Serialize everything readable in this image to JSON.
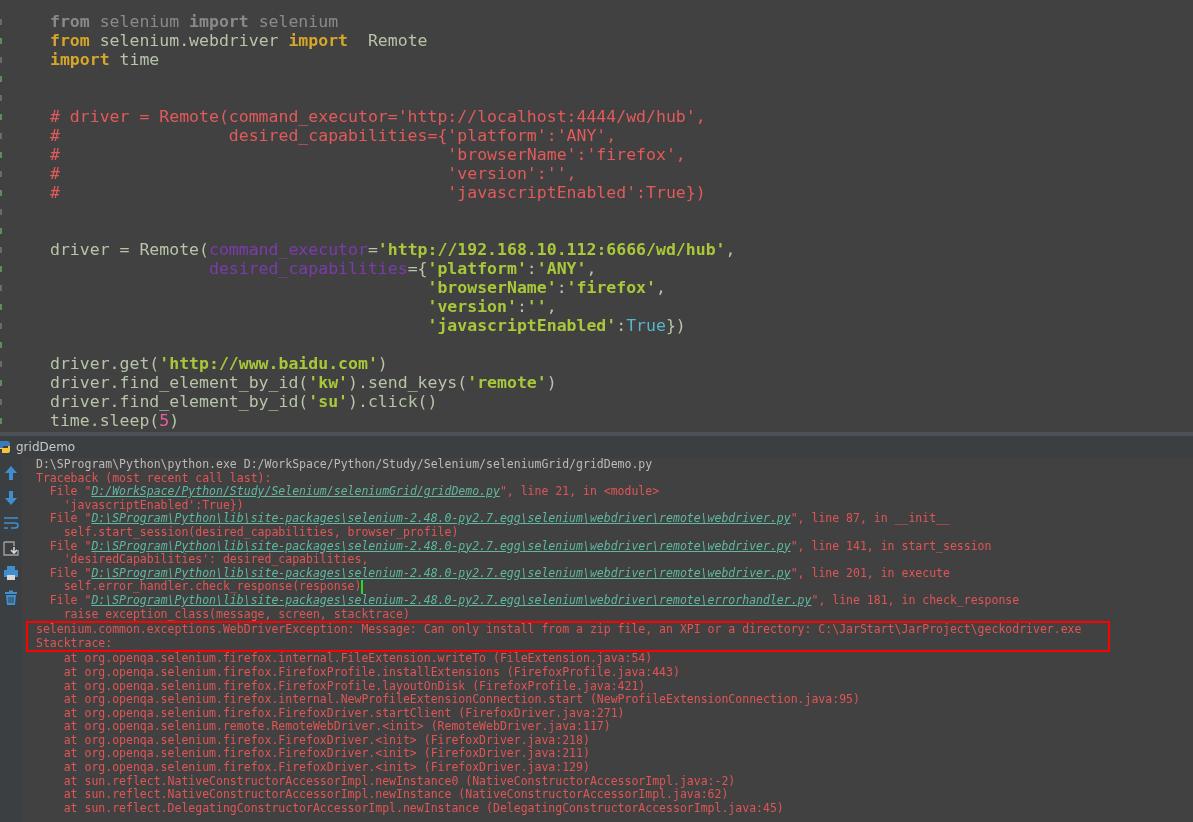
{
  "editor": {
    "lines": [
      {
        "tokens": [
          {
            "kind": "kwdim",
            "text": "from"
          },
          {
            "kind": "dim",
            "text": " selenium "
          },
          {
            "kind": "kwdim",
            "text": "import"
          },
          {
            "kind": "dim",
            "text": " selenium"
          }
        ]
      },
      {
        "tokens": [
          {
            "kind": "kw",
            "text": "from"
          },
          {
            "kind": "plain",
            "text": " selenium.webdriver "
          },
          {
            "kind": "kw",
            "text": "import"
          },
          {
            "kind": "plain",
            "text": "  Remote"
          }
        ]
      },
      {
        "tokens": [
          {
            "kind": "kw",
            "text": "import"
          },
          {
            "kind": "plain",
            "text": " time"
          }
        ]
      },
      {
        "kind": "blank"
      },
      {
        "kind": "blank"
      },
      {
        "tokens": [
          {
            "kind": "comment",
            "text": "# driver = Remote(command_executor='http://localhost:4444/wd/hub',"
          }
        ]
      },
      {
        "tokens": [
          {
            "kind": "comment",
            "text": "#                 desired_capabilities={'platform':'ANY',"
          }
        ]
      },
      {
        "tokens": [
          {
            "kind": "comment",
            "text": "#                                       'browserName':'firefox',"
          }
        ]
      },
      {
        "tokens": [
          {
            "kind": "comment",
            "text": "#                                       'version':'',"
          }
        ]
      },
      {
        "tokens": [
          {
            "kind": "comment",
            "text": "#                                       'javascriptEnabled':True})"
          }
        ]
      },
      {
        "kind": "blank"
      },
      {
        "kind": "blank"
      },
      {
        "tokens": [
          {
            "kind": "plain",
            "text": "driver = Remote("
          },
          {
            "kind": "param",
            "text": "command_executor"
          },
          {
            "kind": "plain",
            "text": "="
          },
          {
            "kind": "str",
            "text": "'http://192.168.10.112:6666/wd/hub'"
          },
          {
            "kind": "plain",
            "text": ","
          }
        ]
      },
      {
        "tokens": [
          {
            "kind": "param",
            "text": "                desired_capabilities"
          },
          {
            "kind": "plain",
            "text": "={"
          },
          {
            "kind": "str",
            "text": "'platform'"
          },
          {
            "kind": "plain",
            "text": ":"
          },
          {
            "kind": "str",
            "text": "'ANY'"
          },
          {
            "kind": "plain",
            "text": ","
          }
        ]
      },
      {
        "tokens": [
          {
            "kind": "str",
            "text": "                                      'browserName'"
          },
          {
            "kind": "plain",
            "text": ":"
          },
          {
            "kind": "str",
            "text": "'firefox'"
          },
          {
            "kind": "plain",
            "text": ","
          }
        ]
      },
      {
        "tokens": [
          {
            "kind": "str",
            "text": "                                      'version'"
          },
          {
            "kind": "plain",
            "text": ":"
          },
          {
            "kind": "str",
            "text": "''"
          },
          {
            "kind": "plain",
            "text": ","
          }
        ]
      },
      {
        "tokens": [
          {
            "kind": "str",
            "text": "                                      'javascriptEnabled'"
          },
          {
            "kind": "plain",
            "text": ":"
          },
          {
            "kind": "const",
            "text": "True"
          },
          {
            "kind": "plain",
            "text": "})"
          }
        ]
      },
      {
        "kind": "blank"
      },
      {
        "tokens": [
          {
            "kind": "plain",
            "text": "driver.get("
          },
          {
            "kind": "str",
            "text": "'http://www.baidu.com'"
          },
          {
            "kind": "plain",
            "text": ")"
          }
        ]
      },
      {
        "tokens": [
          {
            "kind": "plain",
            "text": "driver.find_element_by_id("
          },
          {
            "kind": "str",
            "text": "'kw'"
          },
          {
            "kind": "plain",
            "text": ").send_keys("
          },
          {
            "kind": "str",
            "text": "'remote'"
          },
          {
            "kind": "plain",
            "text": ")"
          }
        ]
      },
      {
        "tokens": [
          {
            "kind": "plain",
            "text": "driver.find_element_by_id("
          },
          {
            "kind": "str",
            "text": "'su'"
          },
          {
            "kind": "plain",
            "text": ").click()"
          }
        ]
      },
      {
        "tokens": [
          {
            "kind": "plain",
            "text": "time.sleep("
          },
          {
            "kind": "num",
            "text": "5"
          },
          {
            "kind": "plain",
            "text": ")"
          }
        ]
      }
    ]
  },
  "run_panel": {
    "title": "gridDemo",
    "blocks": [
      {
        "kind": "plain",
        "lines": [
          {
            "segments": [
              {
                "kind": "out",
                "text": "D:\\SProgram\\Python\\python.exe D:/WorkSpace/Python/Study/Selenium/seleniumGrid/gridDemo.py"
              }
            ]
          },
          {
            "segments": [
              {
                "kind": "err",
                "text": "Traceback (most recent call last):"
              }
            ]
          },
          {
            "segments": [
              {
                "kind": "err",
                "text": "  File \""
              },
              {
                "kind": "link",
                "text": "D:/WorkSpace/Python/Study/Selenium/seleniumGrid/gridDemo.py"
              },
              {
                "kind": "err",
                "text": "\", line 21, in <module>"
              }
            ]
          },
          {
            "segments": [
              {
                "kind": "err",
                "text": "    'javascriptEnabled':True})"
              }
            ]
          },
          {
            "segments": [
              {
                "kind": "err",
                "text": "  File \""
              },
              {
                "kind": "link",
                "text": "D:\\SProgram\\Python\\lib\\site-packages\\selenium-2.48.0-py2.7.egg\\selenium\\webdriver\\remote\\webdriver.py"
              },
              {
                "kind": "err",
                "text": "\", line 87, in __init__"
              }
            ]
          },
          {
            "segments": [
              {
                "kind": "err",
                "text": "    self.start_session(desired_capabilities, browser_profile)"
              }
            ]
          },
          {
            "segments": [
              {
                "kind": "err",
                "text": "  File \""
              },
              {
                "kind": "link",
                "text": "D:\\SProgram\\Python\\lib\\site-packages\\selenium-2.48.0-py2.7.egg\\selenium\\webdriver\\remote\\webdriver.py"
              },
              {
                "kind": "err",
                "text": "\", line 141, in start_session"
              }
            ]
          },
          {
            "segments": [
              {
                "kind": "err",
                "text": "    'desiredCapabilities': desired_capabilities,"
              }
            ]
          },
          {
            "segments": [
              {
                "kind": "err",
                "text": "  File \""
              },
              {
                "kind": "link",
                "text": "D:\\SProgram\\Python\\lib\\site-packages\\selenium-2.48.0-py2.7.egg\\selenium\\webdriver\\remote\\webdriver.py"
              },
              {
                "kind": "err",
                "text": "\", line 201, in execute"
              }
            ]
          },
          {
            "segments": [
              {
                "kind": "err",
                "text": "    self.error_handler.check_response(response)"
              },
              {
                "kind": "caret"
              }
            ]
          },
          {
            "segments": [
              {
                "kind": "err",
                "text": "  File \""
              },
              {
                "kind": "link",
                "text": "D:\\SProgram\\Python\\lib\\site-packages\\selenium-2.48.0-py2.7.egg\\selenium\\webdriver\\remote\\errorhandler.py"
              },
              {
                "kind": "err",
                "text": "\", line 181, in check_response"
              }
            ]
          },
          {
            "segments": [
              {
                "kind": "err",
                "text": "    raise exception_class(message, screen, stacktrace)"
              }
            ]
          }
        ]
      },
      {
        "kind": "highlighted",
        "lines": [
          {
            "segments": [
              {
                "kind": "err",
                "text": "selenium.common.exceptions.WebDriverException: Message: Can only install from a zip file, an XPI or a directory: C:\\JarStart\\JarProject\\geckodriver.exe"
              }
            ]
          },
          {
            "segments": [
              {
                "kind": "err",
                "text": "Stacktrace:"
              }
            ]
          }
        ]
      },
      {
        "kind": "plain",
        "lines": [
          {
            "segments": [
              {
                "kind": "err",
                "text": "    at org.openqa.selenium.firefox.internal.FileExtension.writeTo (FileExtension.java:54)"
              }
            ]
          },
          {
            "segments": [
              {
                "kind": "err",
                "text": "    at org.openqa.selenium.firefox.FirefoxProfile.installExtensions (FirefoxProfile.java:443)"
              }
            ]
          },
          {
            "segments": [
              {
                "kind": "err",
                "text": "    at org.openqa.selenium.firefox.FirefoxProfile.layoutOnDisk (FirefoxProfile.java:421)"
              }
            ]
          },
          {
            "segments": [
              {
                "kind": "err",
                "text": "    at org.openqa.selenium.firefox.internal.NewProfileExtensionConnection.start (NewProfileExtensionConnection.java:95)"
              }
            ]
          },
          {
            "segments": [
              {
                "kind": "err",
                "text": "    at org.openqa.selenium.firefox.FirefoxDriver.startClient (FirefoxDriver.java:271)"
              }
            ]
          },
          {
            "segments": [
              {
                "kind": "err",
                "text": "    at org.openqa.selenium.remote.RemoteWebDriver.<init> (RemoteWebDriver.java:117)"
              }
            ]
          },
          {
            "segments": [
              {
                "kind": "err",
                "text": "    at org.openqa.selenium.firefox.FirefoxDriver.<init> (FirefoxDriver.java:218)"
              }
            ]
          },
          {
            "segments": [
              {
                "kind": "err",
                "text": "    at org.openqa.selenium.firefox.FirefoxDriver.<init> (FirefoxDriver.java:211)"
              }
            ]
          },
          {
            "segments": [
              {
                "kind": "err",
                "text": "    at org.openqa.selenium.firefox.FirefoxDriver.<init> (FirefoxDriver.java:129)"
              }
            ]
          },
          {
            "segments": [
              {
                "kind": "err",
                "text": "    at sun.reflect.NativeConstructorAccessorImpl.newInstance0 (NativeConstructorAccessorImpl.java:-2)"
              }
            ]
          },
          {
            "segments": [
              {
                "kind": "err",
                "text": "    at sun.reflect.NativeConstructorAccessorImpl.newInstance (NativeConstructorAccessorImpl.java:62)"
              }
            ]
          },
          {
            "segments": [
              {
                "kind": "err",
                "text": "    at sun.reflect.DelegatingConstructorAccessorImpl.newInstance (DelegatingConstructorAccessorImpl.java:45)"
              }
            ]
          }
        ]
      }
    ]
  }
}
